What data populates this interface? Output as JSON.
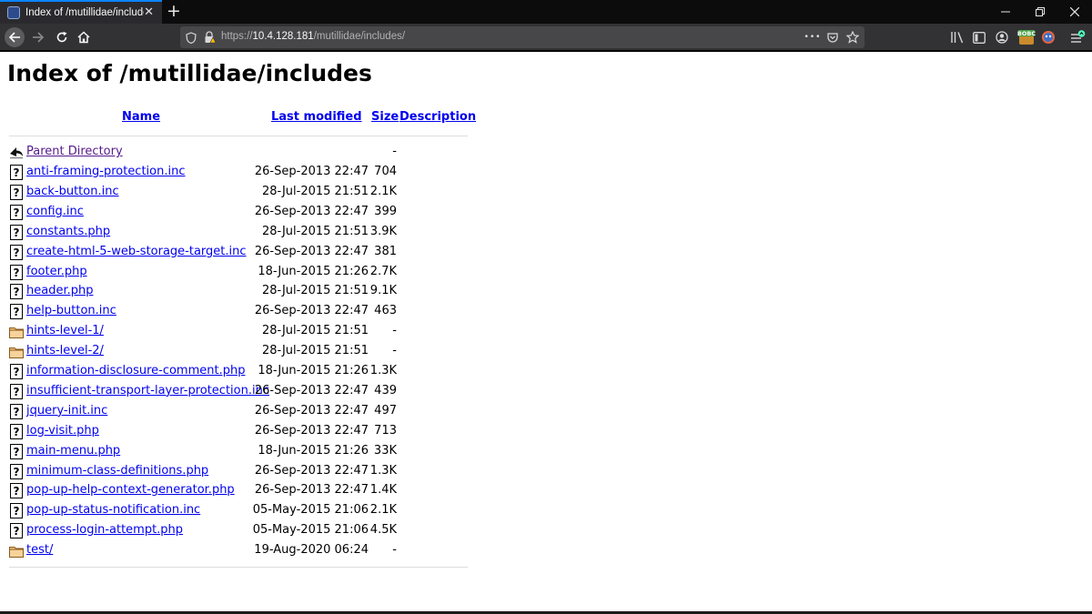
{
  "browser": {
    "tab_title": "Index of /mutillidae/includes",
    "tab_close": "✕",
    "new_tab": "+",
    "url_scheme": "https://",
    "url_host": "10.4.128.181",
    "url_path": "/mutillidae/includes/",
    "url_more": "•••",
    "extension_badge": "BOBC",
    "colors": {
      "tab_accent": "#0a84ff",
      "toolbar": "#323234",
      "tabbar": "#0c0c0d"
    }
  },
  "page": {
    "title": "Index of /mutillidae/includes",
    "columns": {
      "name": "Name",
      "last_modified": "Last modified",
      "size": "Size",
      "description": "Description"
    },
    "parent": {
      "label": "Parent Directory",
      "size": "-",
      "icon": "back-arrow-icon"
    },
    "entries": [
      {
        "name": "anti-framing-protection.inc",
        "modified": "26-Sep-2013 22:47",
        "size": "704",
        "icon": "unknown-file-icon"
      },
      {
        "name": "back-button.inc",
        "modified": "28-Jul-2015 21:51",
        "size": "2.1K",
        "icon": "unknown-file-icon"
      },
      {
        "name": "config.inc",
        "modified": "26-Sep-2013 22:47",
        "size": "399",
        "icon": "unknown-file-icon"
      },
      {
        "name": "constants.php",
        "modified": "28-Jul-2015 21:51",
        "size": "3.9K",
        "icon": "unknown-file-icon"
      },
      {
        "name": "create-html-5-web-storage-target.inc",
        "modified": "26-Sep-2013 22:47",
        "size": "381",
        "icon": "unknown-file-icon"
      },
      {
        "name": "footer.php",
        "modified": "18-Jun-2015 21:26",
        "size": "2.7K",
        "icon": "unknown-file-icon"
      },
      {
        "name": "header.php",
        "modified": "28-Jul-2015 21:51",
        "size": "9.1K",
        "icon": "unknown-file-icon"
      },
      {
        "name": "help-button.inc",
        "modified": "26-Sep-2013 22:47",
        "size": "463",
        "icon": "unknown-file-icon"
      },
      {
        "name": "hints-level-1/",
        "modified": "28-Jul-2015 21:51",
        "size": "-",
        "icon": "folder-icon"
      },
      {
        "name": "hints-level-2/",
        "modified": "28-Jul-2015 21:51",
        "size": "-",
        "icon": "folder-icon"
      },
      {
        "name": "information-disclosure-comment.php",
        "modified": "18-Jun-2015 21:26",
        "size": "1.3K",
        "icon": "unknown-file-icon"
      },
      {
        "name": "insufficient-transport-layer-protection.inc",
        "modified": "26-Sep-2013 22:47",
        "size": "439",
        "icon": "unknown-file-icon"
      },
      {
        "name": "jquery-init.inc",
        "modified": "26-Sep-2013 22:47",
        "size": "497",
        "icon": "unknown-file-icon"
      },
      {
        "name": "log-visit.php",
        "modified": "26-Sep-2013 22:47",
        "size": "713",
        "icon": "unknown-file-icon"
      },
      {
        "name": "main-menu.php",
        "modified": "18-Jun-2015 21:26",
        "size": "33K",
        "icon": "unknown-file-icon"
      },
      {
        "name": "minimum-class-definitions.php",
        "modified": "26-Sep-2013 22:47",
        "size": "1.3K",
        "icon": "unknown-file-icon"
      },
      {
        "name": "pop-up-help-context-generator.php",
        "modified": "26-Sep-2013 22:47",
        "size": "1.4K",
        "icon": "unknown-file-icon"
      },
      {
        "name": "pop-up-status-notification.inc",
        "modified": "05-May-2015 21:06",
        "size": "2.1K",
        "icon": "unknown-file-icon"
      },
      {
        "name": "process-login-attempt.php",
        "modified": "05-May-2015 21:06",
        "size": "4.5K",
        "icon": "unknown-file-icon"
      },
      {
        "name": "test/",
        "modified": "19-Aug-2020 06:24",
        "size": "-",
        "icon": "folder-icon"
      }
    ]
  }
}
